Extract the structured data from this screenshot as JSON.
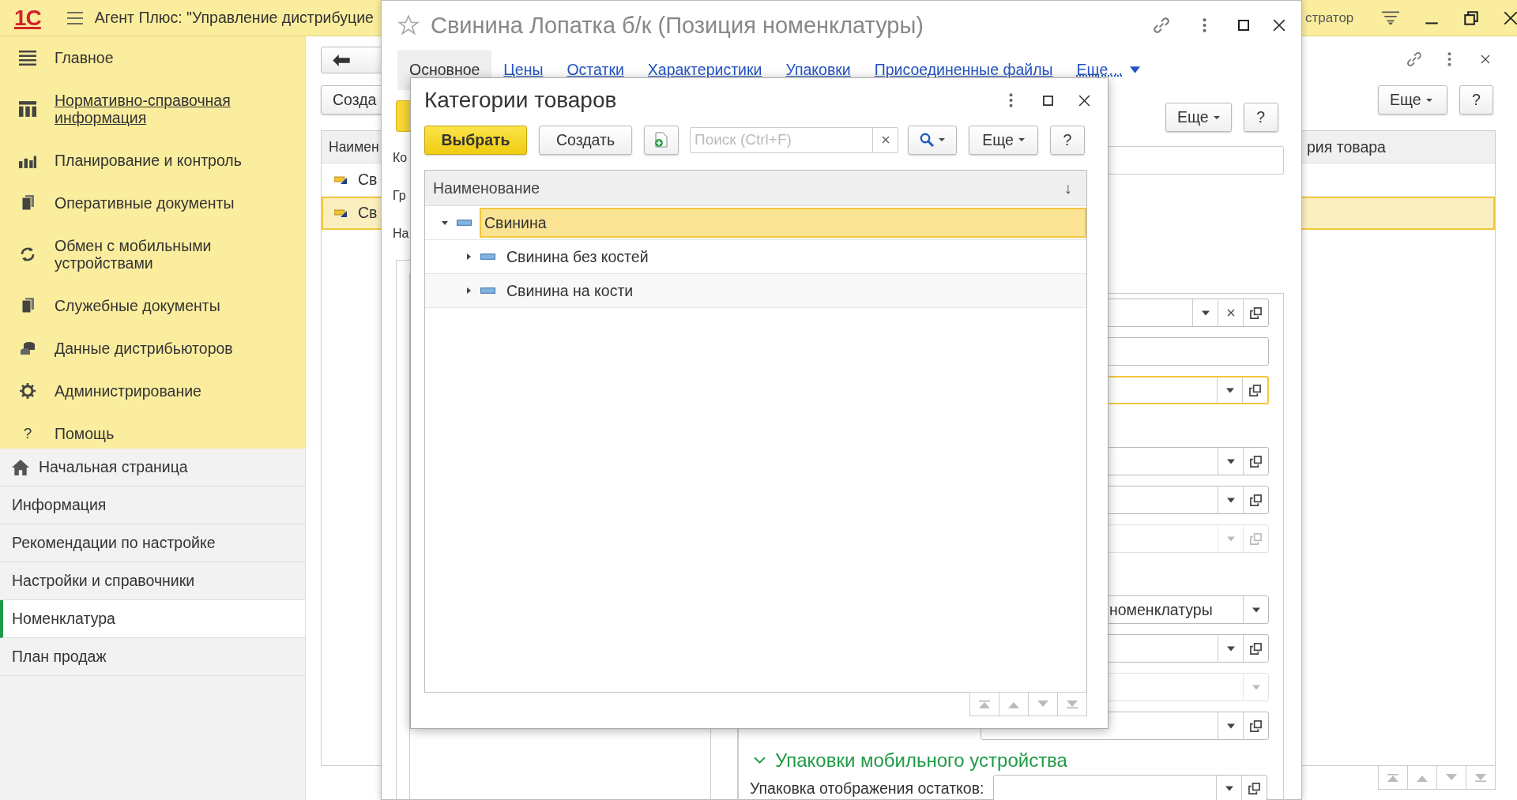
{
  "app": {
    "logo": "1С",
    "title": "Агент Плюс: \"Управление дистрибуцие",
    "user": "стратор"
  },
  "sections": [
    {
      "label": "Главное",
      "selected": false
    },
    {
      "label": "Нормативно-справочная информация",
      "selected": true
    },
    {
      "label": "Планирование и контроль",
      "selected": false
    },
    {
      "label": "Оперативные документы",
      "selected": false
    },
    {
      "label": "Обмен с мобильными устройствами",
      "selected": false
    },
    {
      "label": "Служебные документы",
      "selected": false
    },
    {
      "label": "Данные дистрибьюторов",
      "selected": false
    },
    {
      "label": "Администрирование",
      "selected": false
    },
    {
      "label": "Помощь",
      "glyph": "?",
      "selected": false
    }
  ],
  "nav": [
    {
      "label": "Начальная страница",
      "selected": false
    },
    {
      "label": "Информация",
      "selected": false
    },
    {
      "label": "Рекомендации по настройке",
      "selected": false
    },
    {
      "label": "Настройки и справочники",
      "selected": false
    },
    {
      "label": "Номенклатура",
      "selected": true
    },
    {
      "label": "План продаж",
      "selected": false
    }
  ],
  "list_window": {
    "create_button": "Созда",
    "columns": [
      "Наимен",
      "рия товара"
    ],
    "rows": [
      {
        "name": "Св",
        "selected": false
      },
      {
        "name": "Св",
        "selected": true
      }
    ],
    "more_button": "Еще",
    "help_button": "?"
  },
  "item_window": {
    "title": "Свинина Лопатка б/к (Позиция номенклатуры)",
    "tabs": [
      {
        "label": "Основное",
        "selected": true
      },
      {
        "label": "Цены",
        "selected": false
      },
      {
        "label": "Остатки",
        "selected": false
      },
      {
        "label": "Характеристики",
        "selected": false
      },
      {
        "label": "Упаковки",
        "selected": false
      },
      {
        "label": "Присоединенные файлы",
        "selected": false
      }
    ],
    "more_tab": "Еще…",
    "more_button": "Еще",
    "help_button": "?",
    "labels": [
      "Ко",
      "Гр",
      "На"
    ],
    "fields": [
      {
        "kind": "ref-clear",
        "focused": false,
        "disabled": false
      },
      {
        "kind": "text",
        "focused": false,
        "disabled": false
      },
      {
        "kind": "ref",
        "focused": true,
        "disabled": false
      },
      {
        "kind": "ref",
        "focused": false,
        "disabled": false
      },
      {
        "kind": "ref",
        "focused": false,
        "disabled": false
      },
      {
        "kind": "ref",
        "focused": false,
        "disabled": true
      },
      {
        "kind": "select",
        "value": "номенклатуры",
        "focused": false,
        "disabled": false
      },
      {
        "kind": "ref",
        "focused": false,
        "disabled": false
      },
      {
        "kind": "select",
        "focused": false,
        "disabled": true
      },
      {
        "kind": "ref",
        "focused": false,
        "disabled": false
      }
    ],
    "section_title": "Упаковки мобильного устройства",
    "field_label": "Упаковка отображения остатков:"
  },
  "dialog": {
    "title": "Категории товаров",
    "select_button": "Выбрать",
    "create_button": "Создать",
    "search": {
      "placeholder": "Поиск (Ctrl+F)"
    },
    "more_button": "Еще",
    "help_button": "?",
    "column": "Наименование",
    "sort_mark": "↓",
    "rows": [
      {
        "label": "Свинина",
        "expanded": true,
        "selected": true,
        "children": [
          {
            "label": "Свинина без костей",
            "expanded": false,
            "selected": false
          },
          {
            "label": "Свинина на кости",
            "expanded": false,
            "selected": false
          }
        ]
      }
    ]
  }
}
